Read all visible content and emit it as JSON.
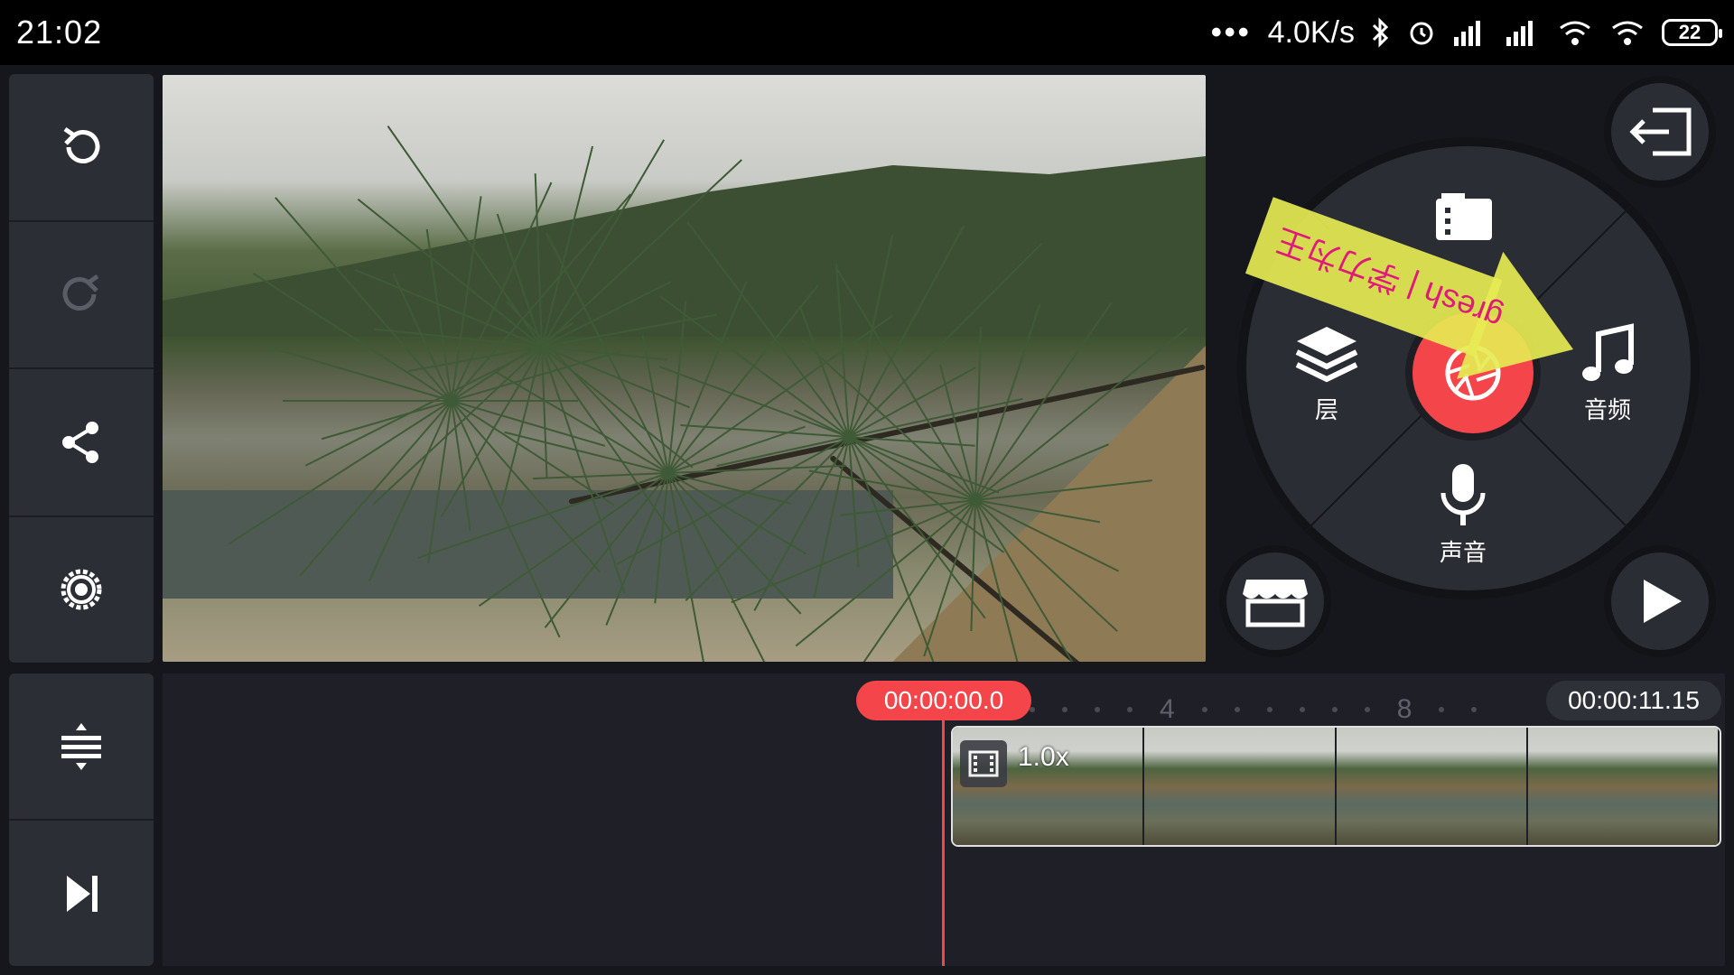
{
  "status_bar": {
    "time": "21:02",
    "dots": "•••",
    "speed": "4.0K/s",
    "battery": "22"
  },
  "left_toolbar": {
    "items": [
      {
        "icon": "undo-icon"
      },
      {
        "icon": "redo-icon"
      },
      {
        "icon": "share-icon"
      },
      {
        "icon": "gear-icon"
      }
    ],
    "bottom_items": [
      {
        "icon": "expand-timeline-icon"
      },
      {
        "icon": "skip-to-end-icon"
      }
    ]
  },
  "wheel": {
    "layer_label": "层",
    "audio_label": "音频",
    "voice_label": "声音",
    "record_icon": "camera-shutter-icon",
    "media_icon": "media-icon"
  },
  "watermark": {
    "text": "gresh | 学力为王"
  },
  "timeline": {
    "current_time": "00:00:00.0",
    "end_time": "00:00:11.15",
    "tick_labels": [
      "4",
      "8"
    ],
    "clip_speed": "1.0x"
  },
  "colors": {
    "accent": "#f4454b",
    "panel": "#2c2e36",
    "background": "#16171c"
  }
}
